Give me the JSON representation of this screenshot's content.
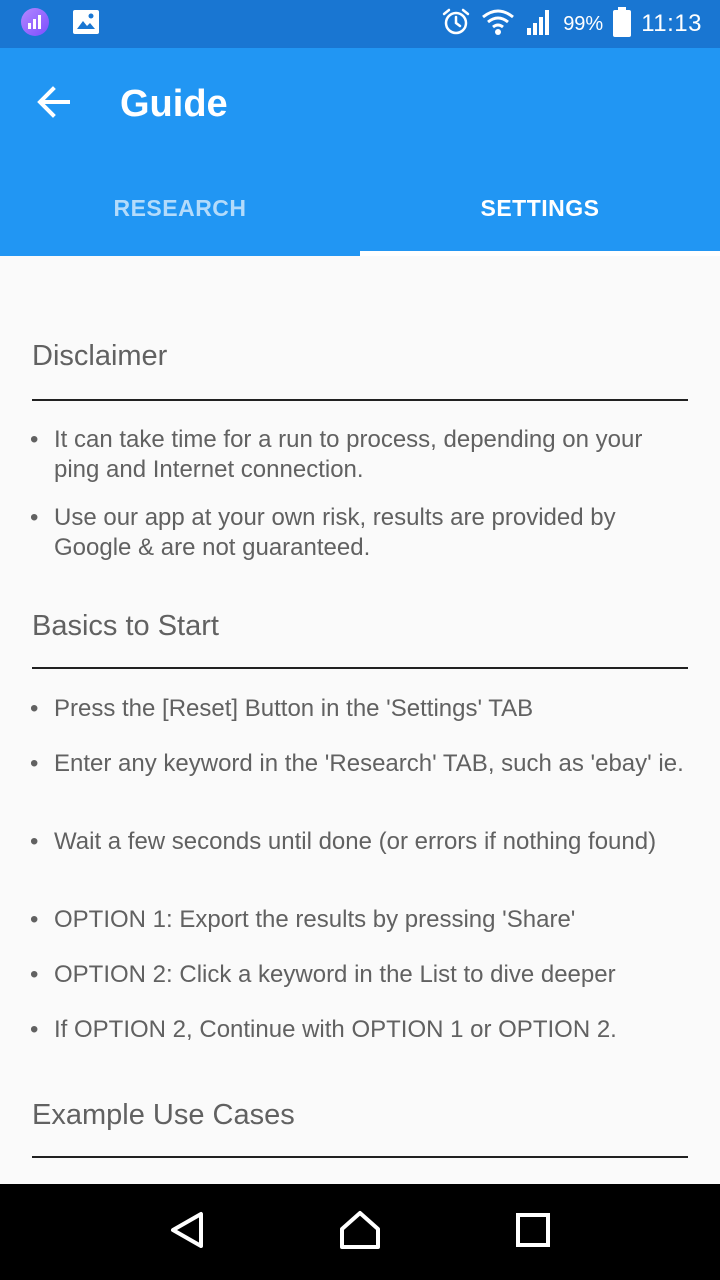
{
  "status_bar": {
    "battery": "99%",
    "time": "11:13"
  },
  "app_bar": {
    "title": "Guide"
  },
  "tabs": [
    {
      "label": "RESEARCH",
      "active": false
    },
    {
      "label": "SETTINGS",
      "active": true
    }
  ],
  "sections": [
    {
      "title": "Disclaimer",
      "items": [
        "It can take time for a run to process, depending on your ping and Internet connection.",
        "Use our app at your own risk, results are provided by Google & are not guaranteed."
      ]
    },
    {
      "title": "Basics to Start",
      "items": [
        "Press the [Reset] Button in the 'Settings' TAB",
        "Enter any keyword in the 'Research' TAB, such as 'ebay' ie.",
        "Wait a few seconds until done (or errors if nothing found)",
        "OPTION 1: Export the results by pressing 'Share'",
        "OPTION 2: Click a keyword in the List to dive deeper",
        "If OPTION 2, Continue with OPTION 1 or OPTION 2."
      ]
    },
    {
      "title": "Example Use Cases",
      "items": []
    }
  ],
  "bullet_char": "•",
  "colors": {
    "status_bar": "#1976d2",
    "app_bar": "#2196f3",
    "text": "#616161"
  }
}
